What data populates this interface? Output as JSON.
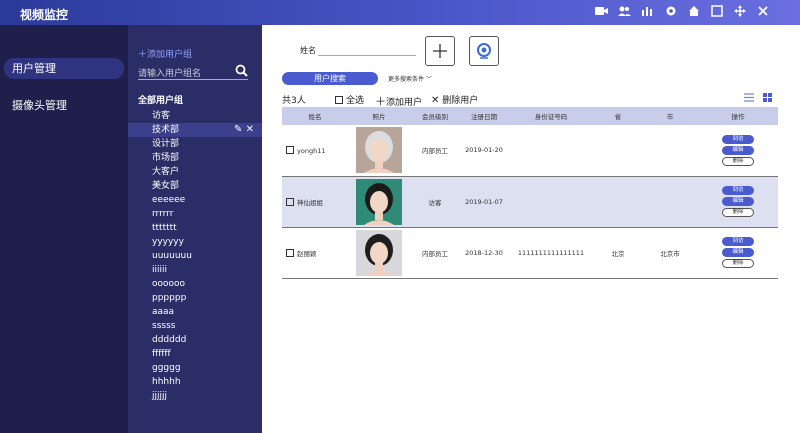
{
  "app": {
    "title": "视频监控"
  },
  "topbar_icons": [
    "camera-icon",
    "users-icon",
    "bar-chart-icon",
    "gear-icon",
    "home-icon",
    "window-icon",
    "move-icon",
    "close-icon"
  ],
  "nav": {
    "items": [
      {
        "label": "用户管理",
        "active": true
      },
      {
        "label": "摄像头管理",
        "active": false
      }
    ]
  },
  "user_panel": {
    "add_group": "添加用户组",
    "search_placeholder": "请输入用户组名",
    "all_groups": "全部用户组",
    "groups": [
      "访客",
      "技术部",
      "设计部",
      "市场部",
      "大客户",
      "美女部",
      "eeeeee",
      "rrrrrr",
      "ttttttt",
      "yyyyyy",
      "uuuuuuu",
      "iiiiii",
      "oooooo",
      "pppppp",
      "aaaa",
      "sssss",
      "dddddd",
      "ffffff",
      "ggggg",
      "hhhhh",
      "jjjjjj"
    ],
    "selected_index": 1
  },
  "main": {
    "name_label": "姓名",
    "name_value": "",
    "search_button": "用户搜索",
    "more_conditions": "更多搜索条件",
    "count_text": "共3人",
    "select_all": "全选",
    "add_user": "添加用户",
    "delete_user": "删除用户"
  },
  "table": {
    "columns": [
      "姓名",
      "照片",
      "会员级别",
      "注册日期",
      "身份证号码",
      "省",
      "市",
      "操作"
    ],
    "rows": [
      {
        "name": "yongh11",
        "level": "内部员工",
        "date": "2019-01-20",
        "id": "",
        "province": "",
        "city": "",
        "highlight": false
      },
      {
        "name": "神仙姐姐",
        "level": "访客",
        "date": "2019-01-07",
        "id": "",
        "province": "",
        "city": "",
        "highlight": true
      },
      {
        "name": "赵丽颖",
        "level": "内部员工",
        "date": "2018-12-30",
        "id": "1111111111111111",
        "province": "北京",
        "city": "北京市",
        "highlight": false
      }
    ],
    "actions": {
      "visit": "到访",
      "edit": "编辑",
      "delete": "删除"
    }
  },
  "colors": {
    "accent": "#4a5bd0",
    "nav_bg": "#1e1f4a",
    "panel_bg": "#2b2d66",
    "header_row": "#c8cdea"
  }
}
